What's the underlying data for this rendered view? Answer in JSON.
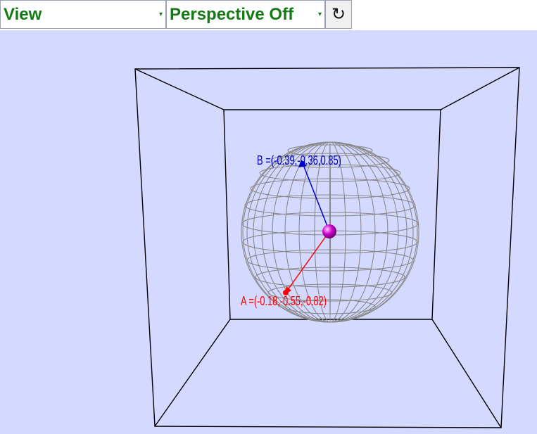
{
  "toolbar": {
    "view_select": "View",
    "perspective_select": "Perspective Off",
    "reset_icon": "↻"
  },
  "scene": {
    "background_color": "#d4d9ff",
    "point_a_label": "A =(-0.18,-0.55,-0.82)",
    "point_b_label": "B =(-0.39,-0.36,0.85)",
    "vector_a_color": "#ff0000",
    "vector_b_color": "#0000cc",
    "center_color": "#cc00cc",
    "sphere_color": "#888888",
    "box_color": "#000000"
  }
}
